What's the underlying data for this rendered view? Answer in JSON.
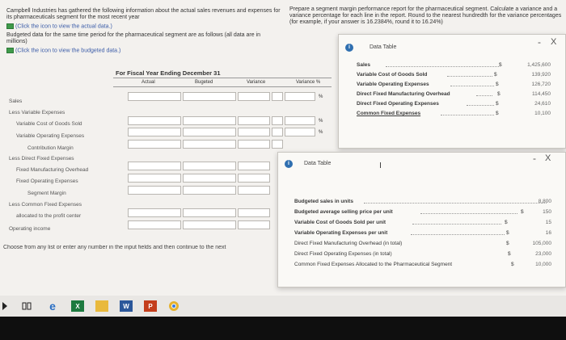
{
  "left": {
    "intro": "Campbell Industries has gathered the following information about the actual sales revenues and expenses for its pharmaceuticals segment for the most recent year",
    "link1": "(Click the icon to view the actual data.)",
    "budget_text": "Budgeted data for the same time period for the pharmaceutical segment are as follows (all data are in millions)",
    "link2": "(Click the icon to view the budgeted data.)"
  },
  "right_text": {
    "text": "Prepare a segment margin performance report for the pharmaceutical segment. Calculate a variance and a variance percentage for each line in the report. Round to the nearest hundredth for the variance percentages (for example, if your answer is 16.2384%, round it to 16.24%)"
  },
  "report": {
    "period": "For Fiscal Year Ending December 31",
    "columns": [
      "Actual",
      "Bugeted",
      "Variance",
      "Variance %"
    ],
    "pct": "%",
    "rows": [
      "Sales",
      "Less Variable Expenses",
      "Variable Cost of Goods Sold",
      "Variable Operating Expenses",
      "Contribution Margin",
      "Less Direct Fixed Expenses",
      "Fixed Manufacturing Overhead",
      "Fixed Operating Expenses",
      "Segment Margin",
      "Less Common Fixed Expenses",
      "allocated to the profit center",
      "Operating income"
    ],
    "footer": "Choose from any list or enter any number in the input fields and then continue to the next"
  },
  "popup1": {
    "title": "Data Table",
    "minimize": "-",
    "close": "X",
    "rows": [
      {
        "label": "Sales",
        "cur": "$",
        "value": "1,425,600"
      },
      {
        "label": "Variable Cost of Goods Sold",
        "cur": "$",
        "value": "139,920"
      },
      {
        "label": "Variable Operating Expenses",
        "cur": "$",
        "value": "126,720"
      },
      {
        "label": "Direct Fixed Manufacturing Overhead",
        "cur": "$",
        "value": "114,450"
      },
      {
        "label": "Direct Fixed Operating Expenses",
        "cur": "$",
        "value": "24,610"
      },
      {
        "label": "Common Fixed Expenses",
        "cur": "$",
        "value": "10,100"
      }
    ]
  },
  "popup2": {
    "title": "Data Table",
    "minimize": "-",
    "close": "X",
    "rows": [
      {
        "label": "Budgeted sales in units",
        "cur": "",
        "value": "8,800"
      },
      {
        "label": "Budgeted average selling price per unit",
        "cur": "$",
        "value": "150"
      },
      {
        "label": "Variable Cost of Goods Sold per unit",
        "cur": "$",
        "value": "15"
      },
      {
        "label": "Variable Operating Expenses per unit",
        "cur": "$",
        "value": "16"
      },
      {
        "label": "Direct Fixed Manufacturing Overhead (in total)",
        "cur": "$",
        "value": "105,000"
      },
      {
        "label": "Direct Fixed Operating Expenses (in total)",
        "cur": "$",
        "value": "23,000"
      },
      {
        "label": "Common Fixed Expenses Allocated to the Pharmaceutical Segment",
        "cur": "$",
        "value": "10,000"
      }
    ]
  },
  "taskbar": {
    "icons": [
      "windows-icon",
      "task-view-icon",
      "edge-icon",
      "excel-icon",
      "file-explorer-icon",
      "word-icon",
      "powerpoint-icon",
      "chrome-icon"
    ],
    "word": "W",
    "ppt": "P",
    "excel": "X"
  },
  "colors": {
    "accent": "#2f6fb0",
    "table_icon": "#3f9a4a"
  }
}
